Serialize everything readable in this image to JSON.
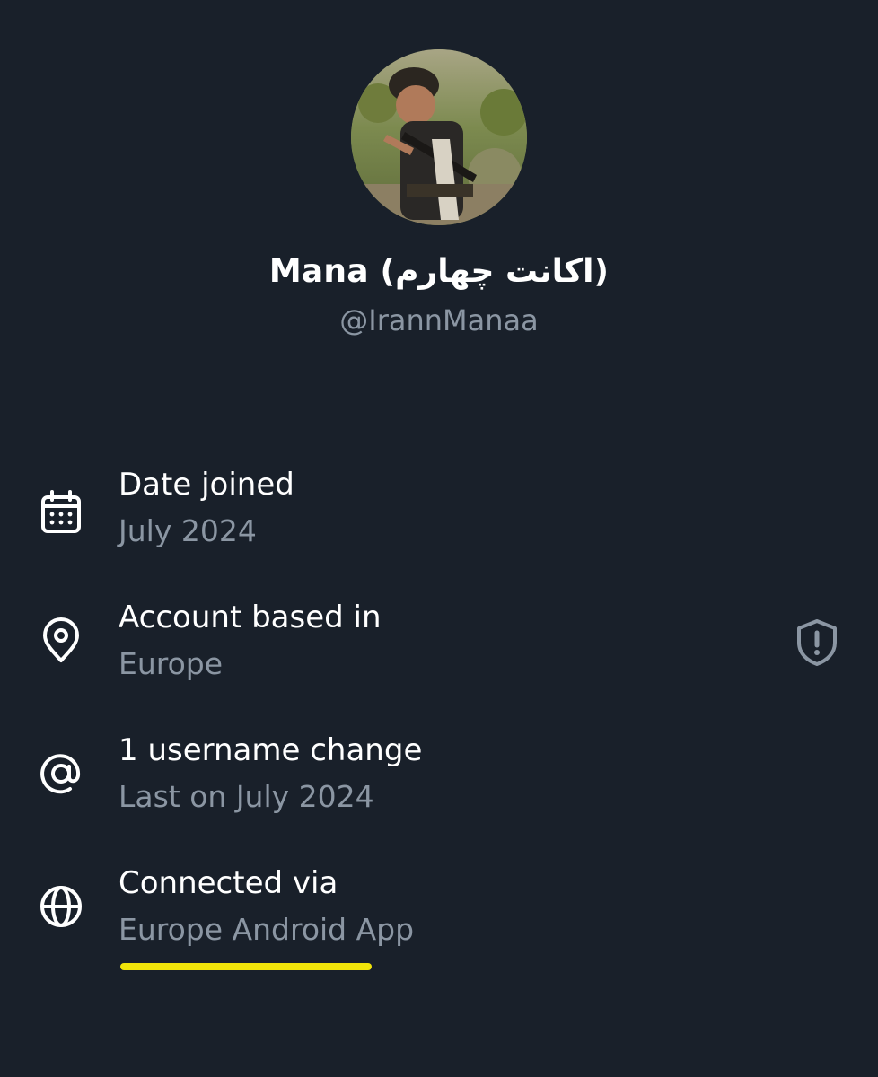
{
  "profile": {
    "display_name": "Mana (اکانت چهارم)",
    "handle": "@IrannManaa",
    "avatar_description_icon": "profile-photo"
  },
  "about": {
    "date_joined": {
      "title": "Date joined",
      "value": "July 2024",
      "icon": "calendar-icon"
    },
    "account_based_in": {
      "title": "Account based in",
      "value": "Europe",
      "icon": "location-pin-icon",
      "badge_icon": "shield-alert-icon"
    },
    "username_changes": {
      "title": "1 username change",
      "value": "Last on July 2024",
      "icon": "at-sign-icon"
    },
    "connected_via": {
      "title": "Connected via",
      "value": "Europe Android App",
      "icon": "globe-icon"
    }
  },
  "colors": {
    "background": "#19202a",
    "primary_text": "#ffffff",
    "secondary_text": "#8b96a3",
    "shield_icon": "#8b96a3",
    "highlight_underline": "#f1e40a"
  }
}
